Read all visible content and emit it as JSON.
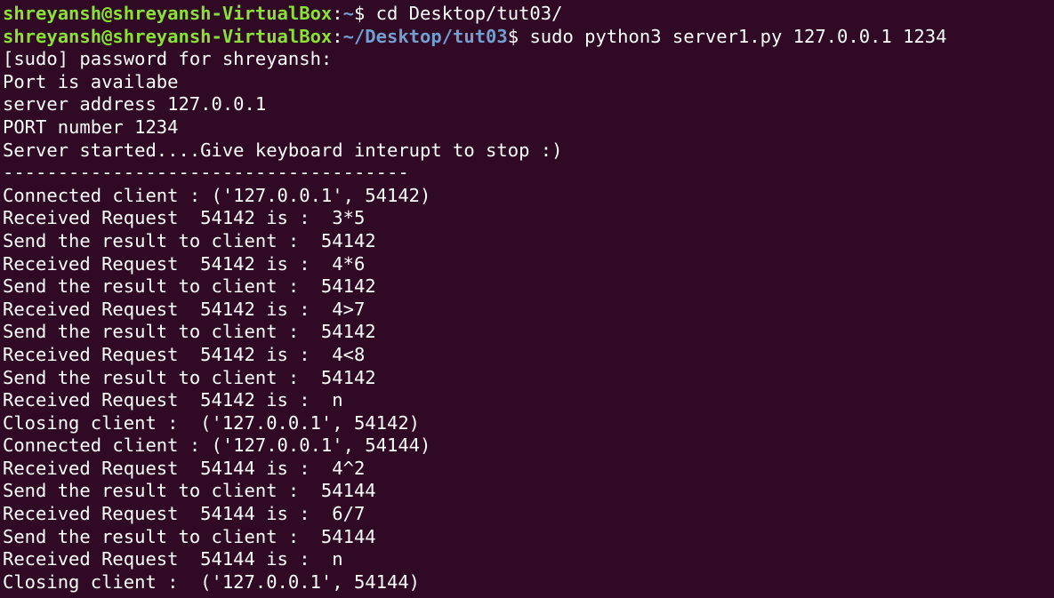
{
  "colors": {
    "background": "#300a24",
    "text": "#ffffff",
    "prompt_user": "#8ae234",
    "prompt_path": "#729fcf"
  },
  "prompts": [
    {
      "user_host": "shreyansh@shreyansh-VirtualBox",
      "separator": ":",
      "path": "~",
      "symbol": "$ ",
      "command": "cd Desktop/tut03/"
    },
    {
      "user_host": "shreyansh@shreyansh-VirtualBox",
      "separator": ":",
      "path": "~/Desktop/tut03",
      "symbol": "$ ",
      "command": "sudo python3 server1.py 127.0.0.1 1234"
    }
  ],
  "output_lines": [
    "[sudo] password for shreyansh:",
    "Port is availabe",
    "server address 127.0.0.1",
    "PORT number 1234",
    "Server started....Give keyboard interupt to stop :)",
    "-------------------------------------",
    "Connected client : ('127.0.0.1', 54142)",
    "Received Request  54142 is :  3*5",
    "Send the result to client :  54142",
    "Received Request  54142 is :  4*6",
    "Send the result to client :  54142",
    "Received Request  54142 is :  4>7",
    "Send the result to client :  54142",
    "Received Request  54142 is :  4<8",
    "Send the result to client :  54142",
    "Received Request  54142 is :  n",
    "Closing client :  ('127.0.0.1', 54142)",
    "Connected client : ('127.0.0.1', 54144)",
    "Received Request  54144 is :  4^2",
    "Send the result to client :  54144",
    "Received Request  54144 is :  6/7",
    "Send the result to client :  54144",
    "Received Request  54144 is :  n",
    "Closing client :  ('127.0.0.1', 54144)"
  ]
}
